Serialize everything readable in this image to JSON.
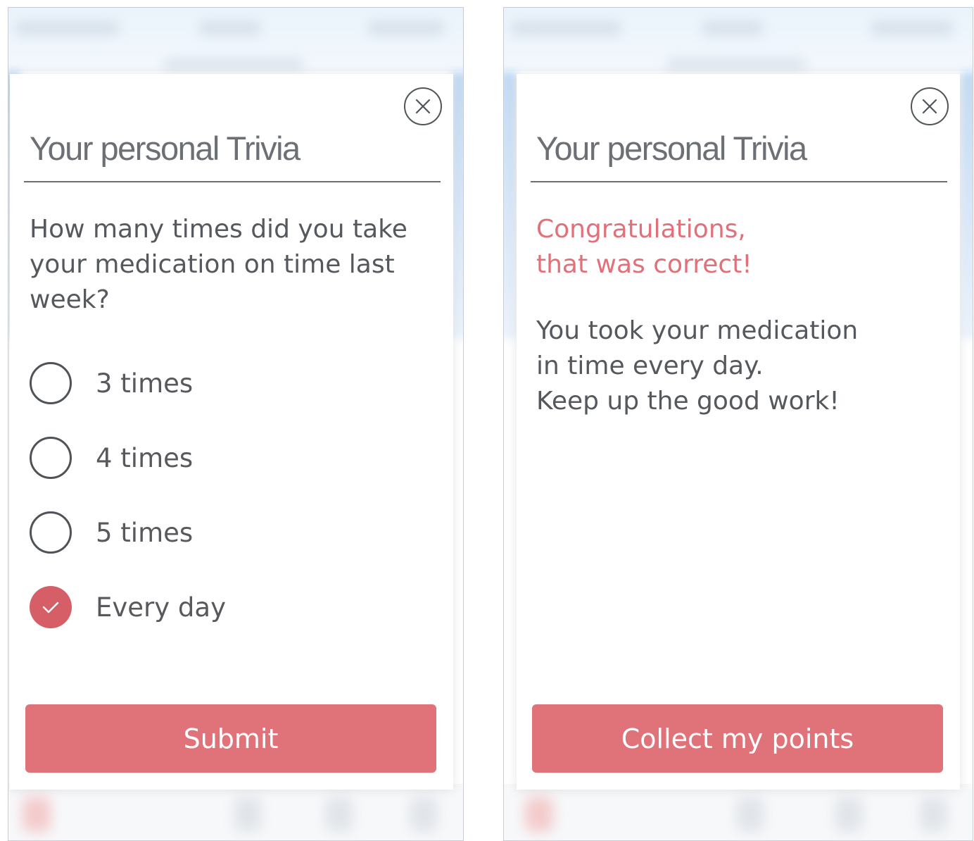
{
  "colors": {
    "accent": "#e0727a",
    "accent_dark": "#d65e66",
    "text": "#55585c",
    "title": "#6c6f73"
  },
  "question_screen": {
    "title": "Your personal Trivia",
    "question": "How many times did you take your medication on time last week?",
    "options": [
      {
        "label": "3 times",
        "checked": false
      },
      {
        "label": "4 times",
        "checked": false
      },
      {
        "label": "5 times",
        "checked": false
      },
      {
        "label": "Every day",
        "checked": true
      }
    ],
    "button": "Submit",
    "close_icon": "close-icon"
  },
  "result_screen": {
    "title": "Your personal Trivia",
    "congrats": "Congratulations,\nthat was correct!",
    "message": "You took your medication\nin time every day.\nKeep up the good work!",
    "button": "Collect my points",
    "close_icon": "close-icon"
  }
}
